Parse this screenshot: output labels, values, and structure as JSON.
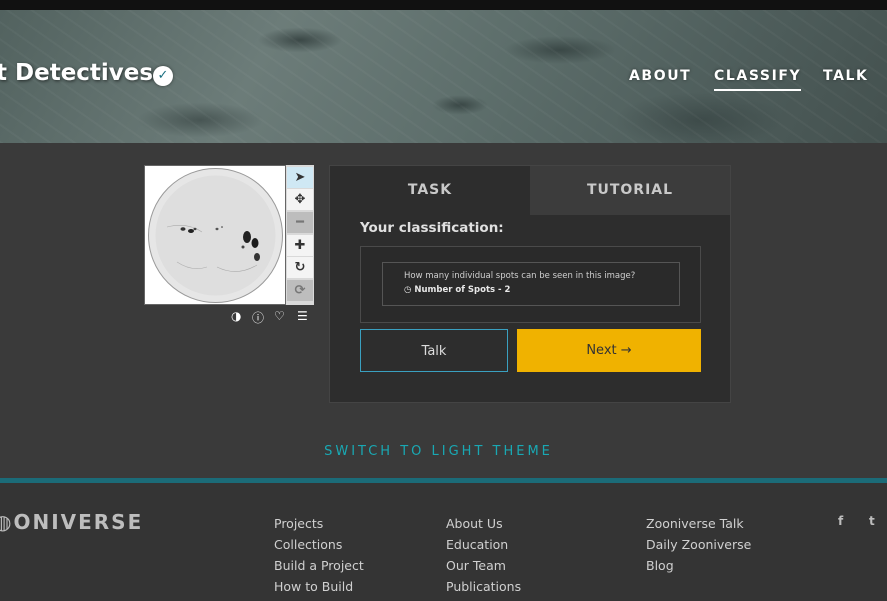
{
  "header": {
    "project_title": "t Detectives",
    "verified_icon": "check-badge-icon",
    "nav": [
      {
        "label": "ABOUT"
      },
      {
        "label": "CLASSIFY",
        "active": true
      },
      {
        "label": "TALK"
      }
    ]
  },
  "viewer": {
    "tools": [
      {
        "icon": "pointer-icon",
        "glyph": "➤",
        "state": "active"
      },
      {
        "icon": "move-icon",
        "glyph": "✥",
        "state": "normal"
      },
      {
        "icon": "zoom-out-icon",
        "glyph": "━",
        "state": "disabled"
      },
      {
        "icon": "zoom-in-icon",
        "glyph": "✚",
        "state": "normal"
      },
      {
        "icon": "rotate-icon",
        "glyph": "↻",
        "state": "normal"
      },
      {
        "icon": "reset-icon",
        "glyph": "⟳",
        "state": "disabled"
      }
    ],
    "meta_icons": [
      {
        "icon": "invert-icon",
        "glyph": "◑"
      },
      {
        "icon": "info-icon",
        "glyph": "ⓘ"
      },
      {
        "icon": "favorite-icon",
        "glyph": "♡"
      },
      {
        "icon": "collections-icon",
        "glyph": "☰"
      }
    ]
  },
  "task_panel": {
    "tabs": {
      "task": "TASK",
      "tutorial": "TUTORIAL"
    },
    "your_classification": "Your classification:",
    "question": "How many individual spots can be seen in this image?",
    "answer": "Number of Spots - 2",
    "answer_icon": "clock-icon",
    "talk_label": "Talk",
    "next_label": "Next",
    "next_icon": "arrow-right-icon"
  },
  "switch_theme": "SWITCH TO LIGHT THEME",
  "footer": {
    "logo": "ONIVERSE",
    "col1": [
      "Projects",
      "Collections",
      "Build a Project",
      "How to Build"
    ],
    "col2": [
      "About Us",
      "Education",
      "Our Team",
      "Publications"
    ],
    "col3": [
      "Zooniverse Talk",
      "Daily Zooniverse",
      "Blog"
    ],
    "social": [
      {
        "icon": "facebook-icon",
        "glyph": "f"
      },
      {
        "icon": "twitter-icon",
        "glyph": "t"
      }
    ]
  },
  "colors": {
    "accent": "#f0b200",
    "teal": "#19a8b3",
    "background": "#3a3a3a"
  }
}
